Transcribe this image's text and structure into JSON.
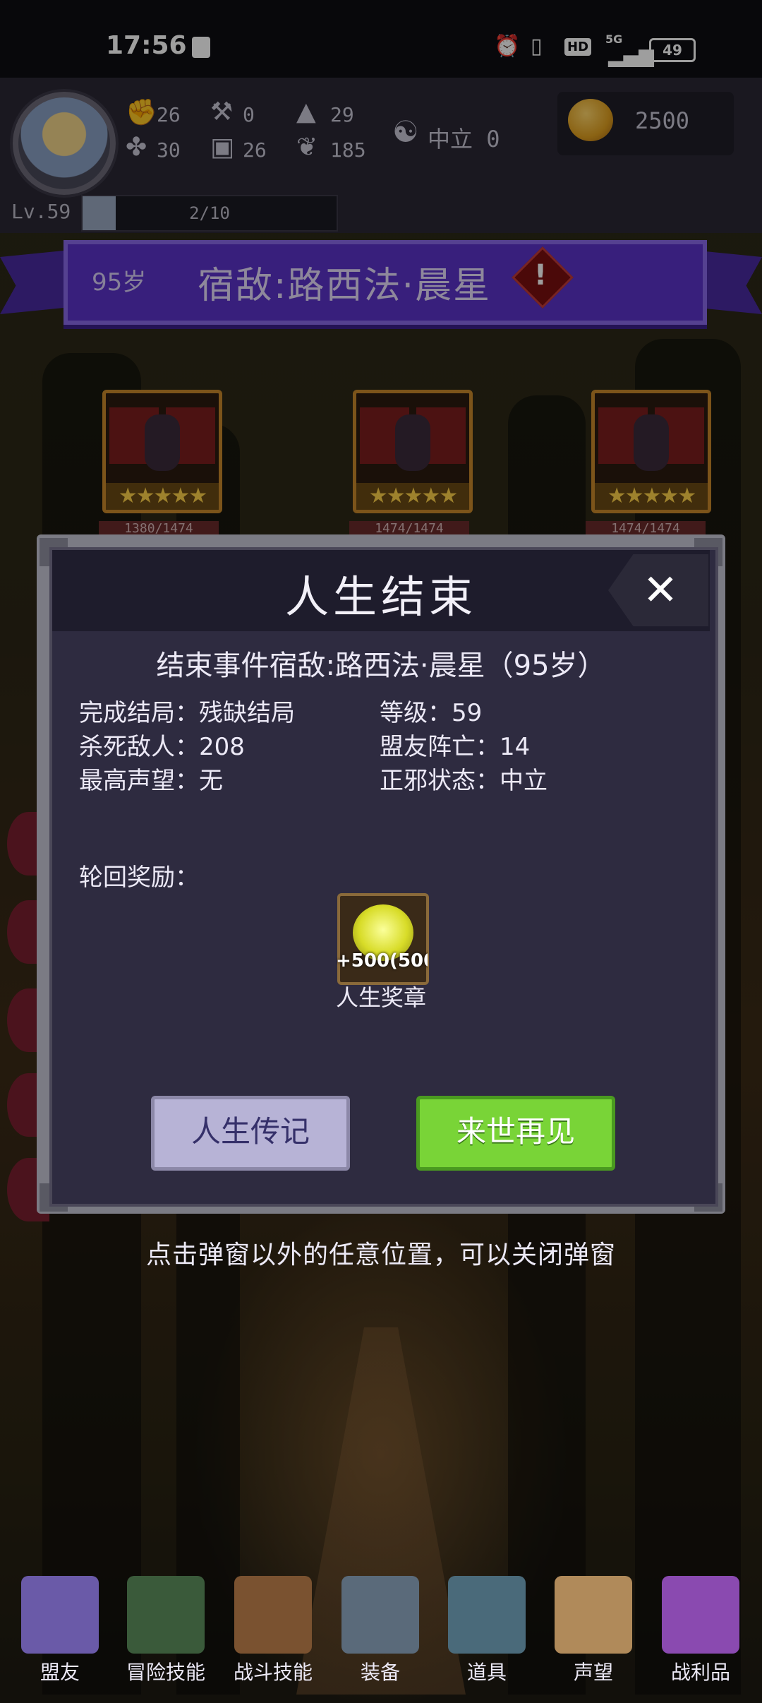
{
  "status_bar": {
    "time": "17:56",
    "battery": "49",
    "network": "5G",
    "hd": "HD"
  },
  "header": {
    "stats": [
      {
        "icon": "fist-icon",
        "value": "26"
      },
      {
        "icon": "clover-icon",
        "value": "30"
      },
      {
        "icon": "axe-icon",
        "value": "0"
      },
      {
        "icon": "armor-icon",
        "value": "26"
      },
      {
        "icon": "wizard-hat-icon",
        "value": "29"
      },
      {
        "icon": "lotus-icon",
        "value": "185"
      }
    ],
    "alignment": "中立 0",
    "gold": "2500",
    "level": "Lv.59",
    "xp_text": "2/10",
    "xp_fraction": 0.13
  },
  "banner": {
    "age": "95岁",
    "enemy": "宿敌:路西法·晨星",
    "warning": "!"
  },
  "cards": [
    {
      "hp": "1380/1474",
      "stars": "★★★★★"
    },
    {
      "hp": "1474/1474",
      "stars": "★★★★★"
    },
    {
      "hp": "1474/1474",
      "stars": "★★★★★"
    }
  ],
  "modal": {
    "title": "人生结束",
    "close": "✕",
    "subtitle": "结束事件宿敌:路西法·晨星（95岁）",
    "left_rows": [
      "完成结局：残缺结局",
      "杀死敌人：208",
      "最高声望：无"
    ],
    "right_rows": [
      "等级：59",
      "盟友阵亡：14",
      "正邪状态：中立"
    ],
    "reward_label": "轮回奖励：",
    "reward_amount": "+500(500",
    "reward_name": "人生奖章",
    "btn_story": "人生传记",
    "btn_rebirth": "来世再见"
  },
  "hint": "点击弹窗以外的任意位置，可以关闭弹窗",
  "nav": [
    {
      "label": "盟友",
      "icon": "handshake-icon",
      "color": "#6a5aa8"
    },
    {
      "label": "冒险技能",
      "icon": "book-icon",
      "color": "#3a5a3a"
    },
    {
      "label": "战斗技能",
      "icon": "backpack-icon",
      "color": "#7a5230"
    },
    {
      "label": "装备",
      "icon": "swords-icon",
      "color": "#5a6a7a"
    },
    {
      "label": "道具",
      "icon": "bag-icon",
      "color": "#4a6a7a"
    },
    {
      "label": "声望",
      "icon": "scroll-icon",
      "color": "#b08a5a"
    },
    {
      "label": "战利品",
      "icon": "chest-icon",
      "color": "#8a4ab0"
    }
  ]
}
